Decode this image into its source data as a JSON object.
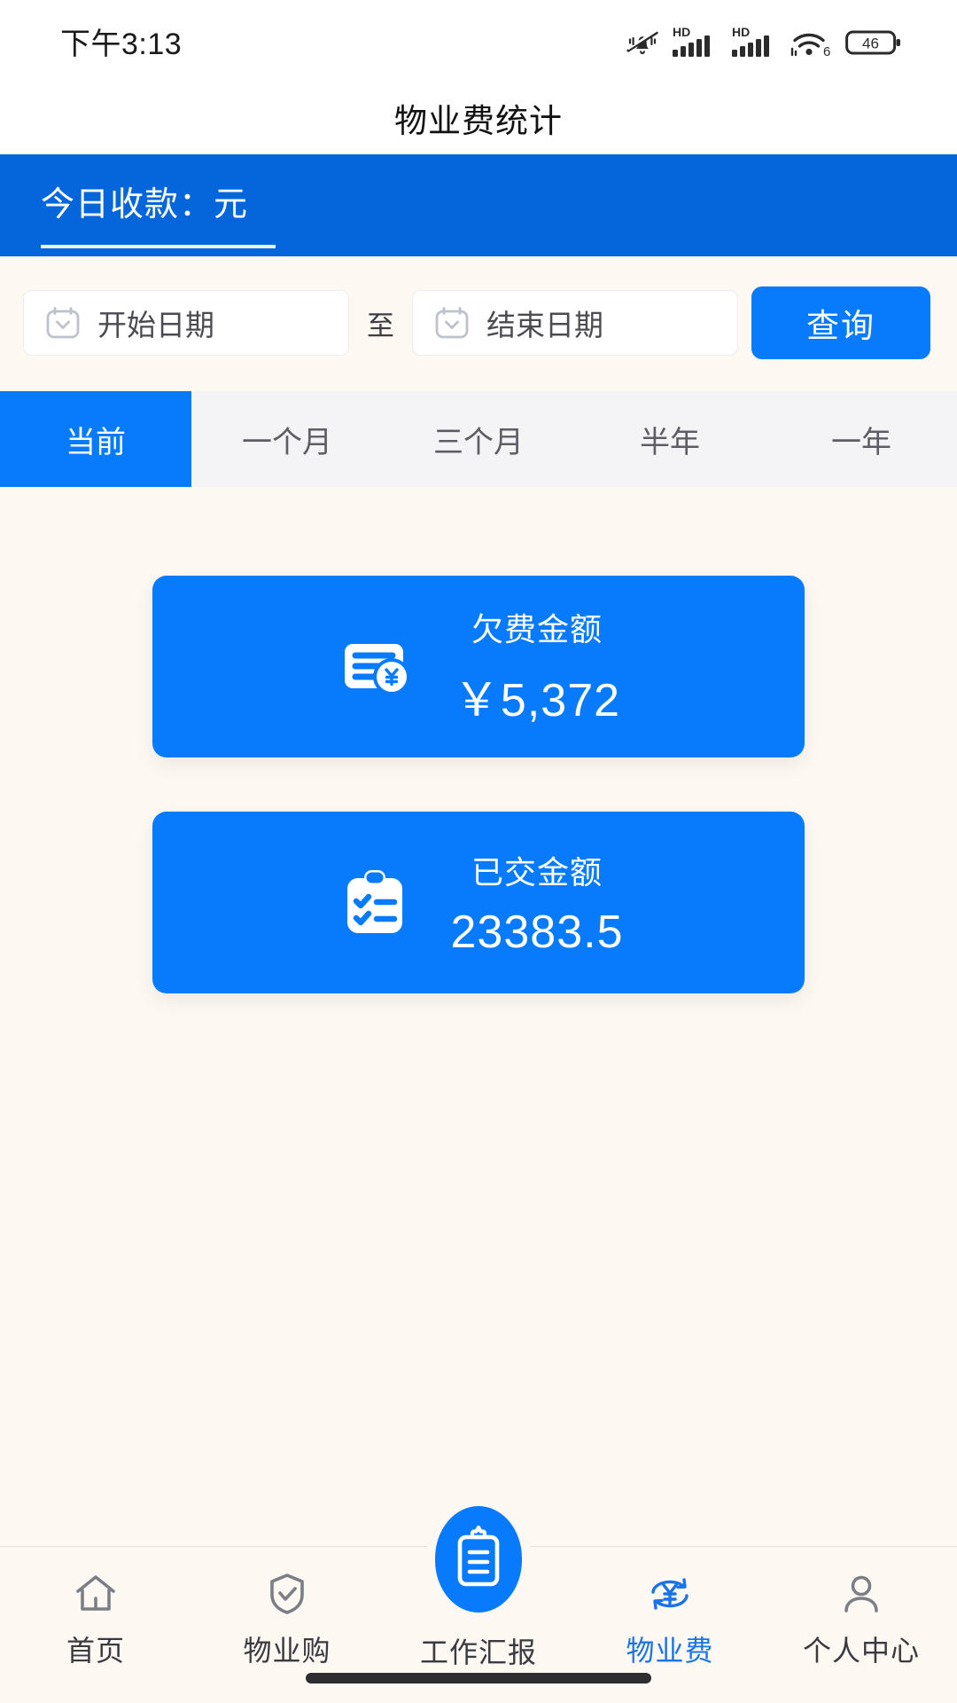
{
  "status_bar": {
    "time": "下午3:13",
    "battery_level": "46",
    "icons": [
      "mute-bell-icon",
      "hd-signal-icon",
      "hd-signal-icon",
      "wifi6-icon",
      "battery-icon"
    ]
  },
  "header": {
    "title": "物业费统计"
  },
  "banner": {
    "label": "今日收款：元"
  },
  "filter": {
    "start_date_placeholder": "开始日期",
    "separator": "至",
    "end_date_placeholder": "结束日期",
    "query_label": "查询"
  },
  "tabs": [
    {
      "label": "当前",
      "active": true
    },
    {
      "label": "一个月",
      "active": false
    },
    {
      "label": "三个月",
      "active": false
    },
    {
      "label": "半年",
      "active": false
    },
    {
      "label": "一年",
      "active": false
    }
  ],
  "cards": [
    {
      "label": "欠费金额",
      "value": "￥5,372",
      "icon": "bill-yen-icon"
    },
    {
      "label": "已交金额",
      "value": "23383.5",
      "icon": "clipboard-check-icon"
    }
  ],
  "bottom_nav": [
    {
      "label": "首页",
      "icon": "home-icon",
      "active": false
    },
    {
      "label": "物业购",
      "icon": "shield-check-icon",
      "active": false
    },
    {
      "label": "工作汇报",
      "icon": "clipboard-icon",
      "active": false
    },
    {
      "label": "物业费",
      "icon": "yen-refresh-icon",
      "active": true
    },
    {
      "label": "个人中心",
      "icon": "person-icon",
      "active": false
    }
  ],
  "colors": {
    "accent": "#077BFC",
    "banner": "#0566DC",
    "background": "#FEF8F3",
    "tabbar": "#F4F4F6",
    "active_nav": "#1A73E8"
  }
}
